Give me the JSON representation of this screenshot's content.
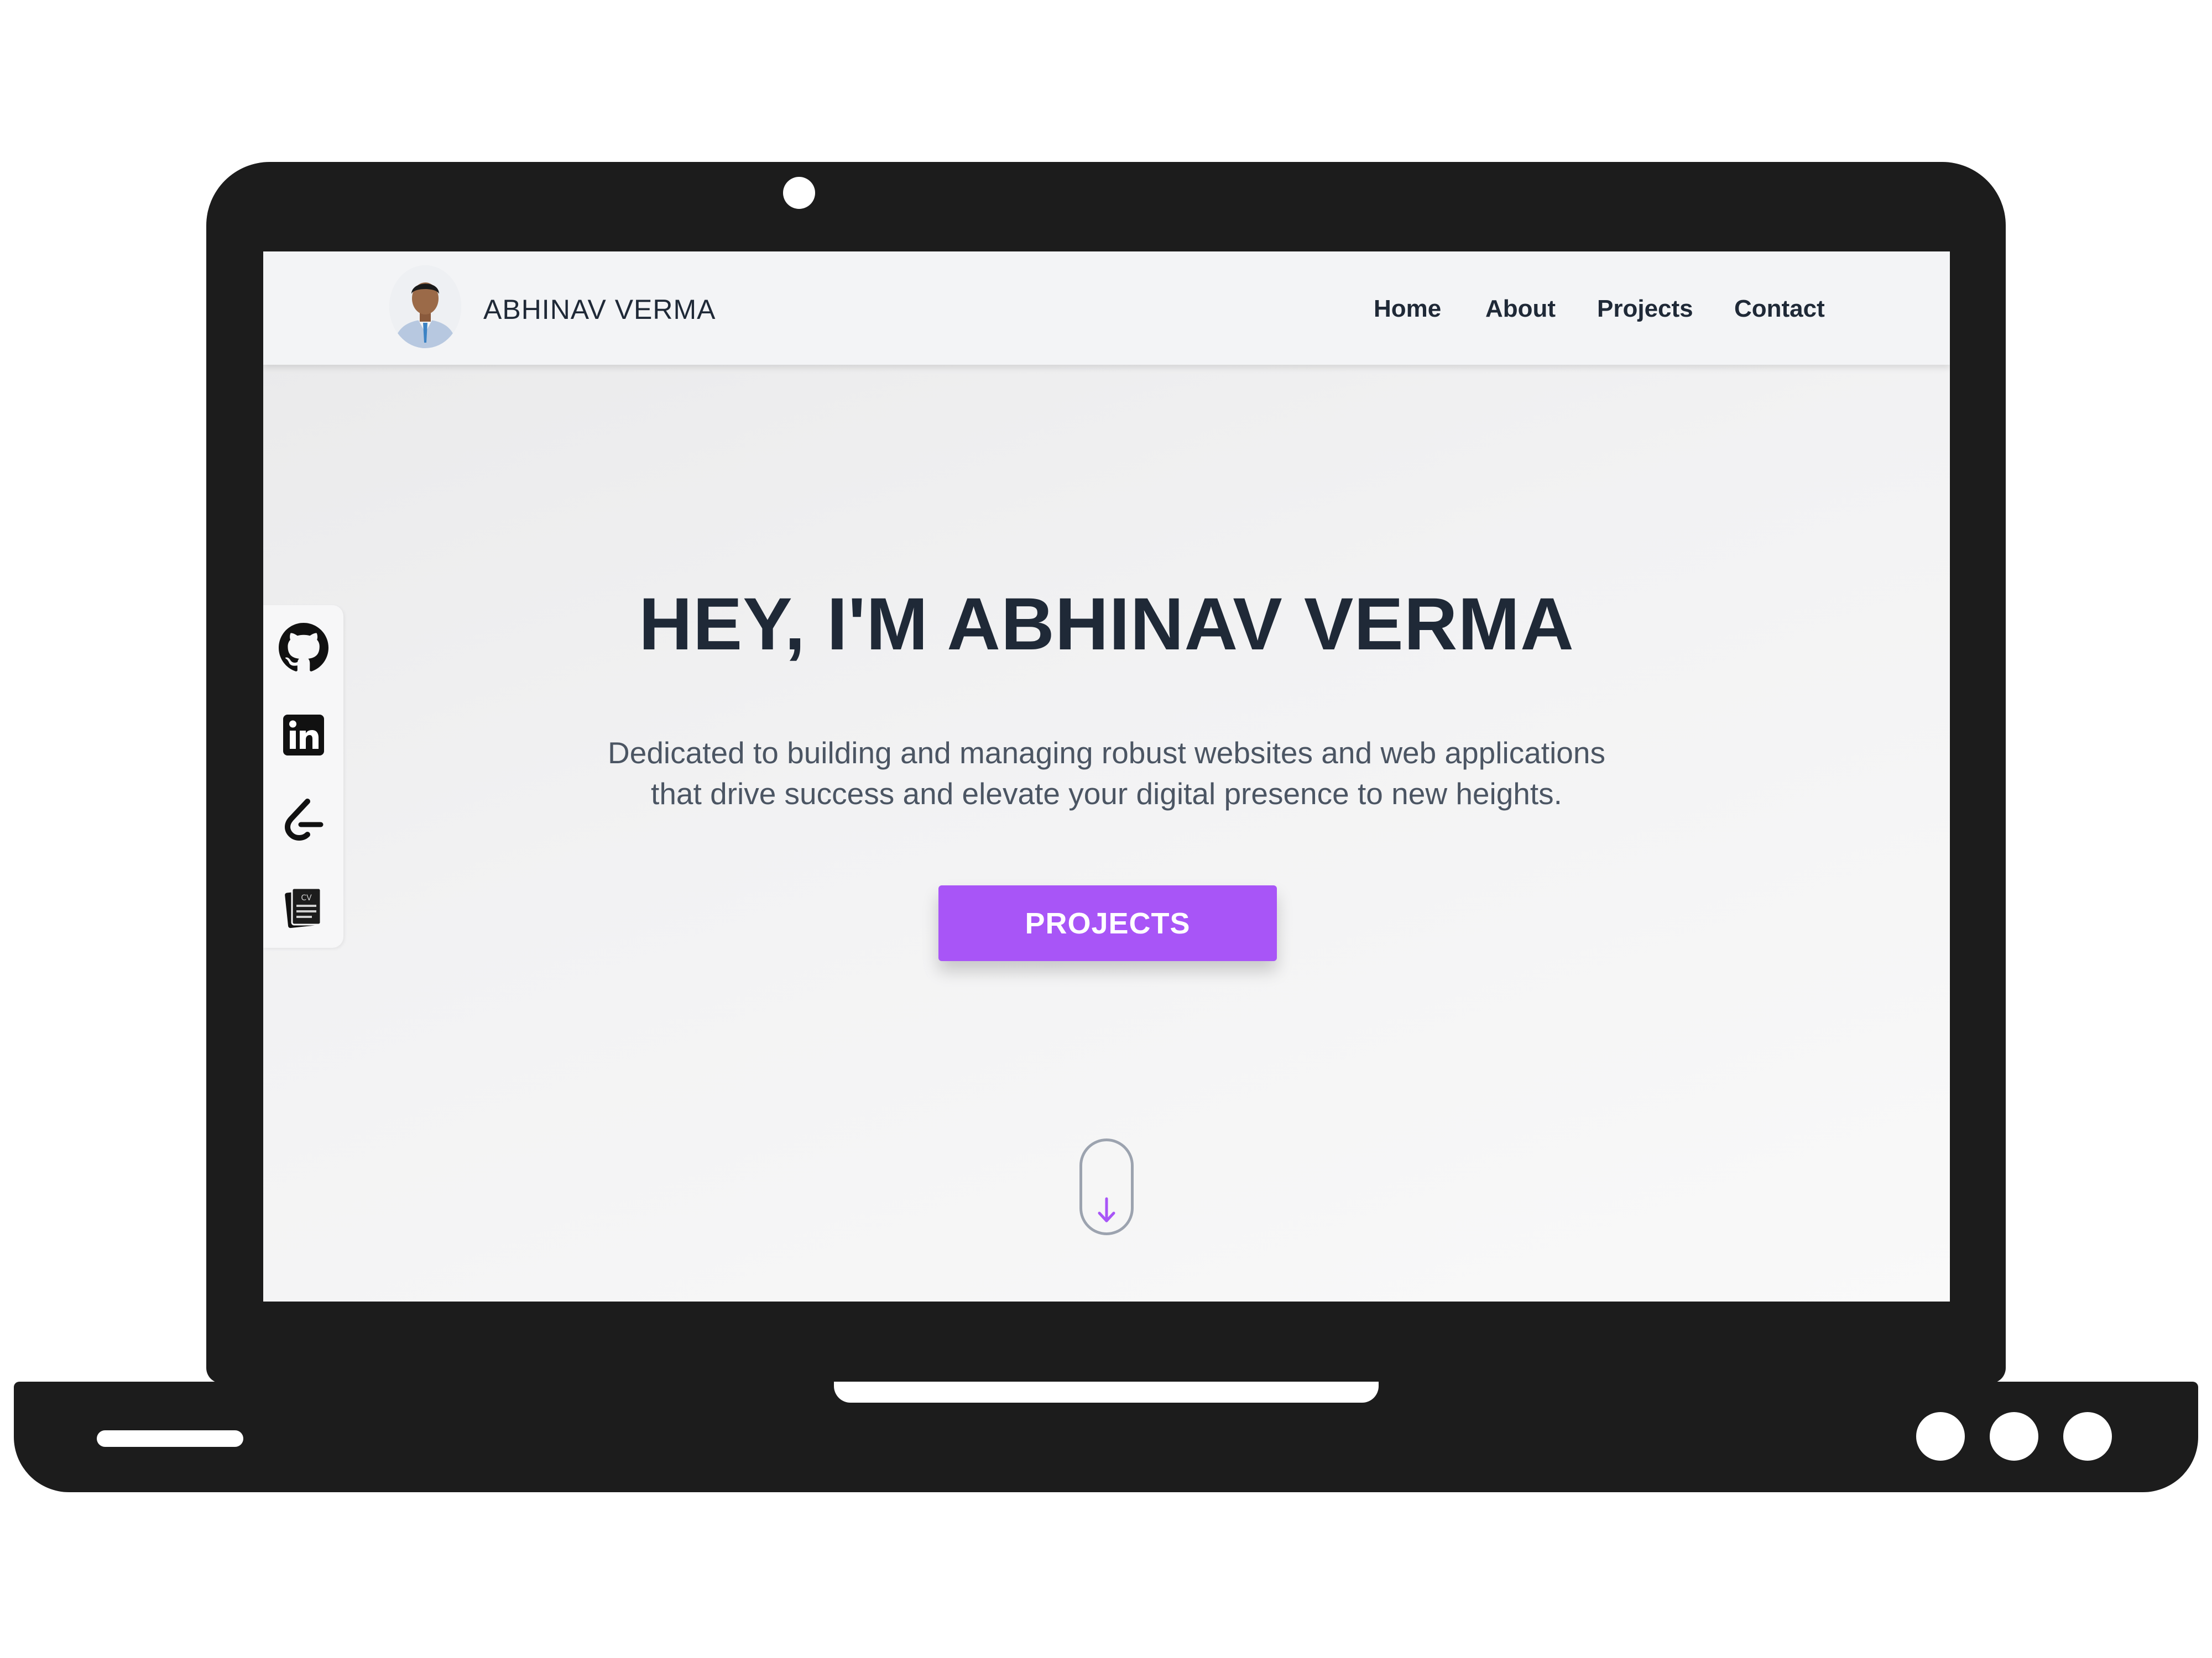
{
  "navbar": {
    "brand": "ABHINAV VERMA",
    "avatar_alt": "profile photo",
    "links": [
      "Home",
      "About",
      "Projects",
      "Contact"
    ]
  },
  "social": {
    "icons": [
      "github-icon",
      "linkedin-icon",
      "leetcode-icon",
      "resume-cv-icon"
    ],
    "cv_badge": "CV"
  },
  "hero": {
    "title": "HEY, I'M ABHINAV VERMA",
    "subtitle_line1": "Dedicated to building and managing robust websites and web applications",
    "subtitle_line2": "that drive success and elevate your digital presence to new heights.",
    "cta_label": "PROJECTS"
  },
  "scroll_indicator": {
    "icon": "arrow-down-icon"
  },
  "colors": {
    "accent": "#a855f7",
    "text_dark": "#1f2937",
    "text_muted": "#4b5563",
    "navbar_bg": "#f3f4f6",
    "laptop_frame": "#1c1c1c"
  }
}
